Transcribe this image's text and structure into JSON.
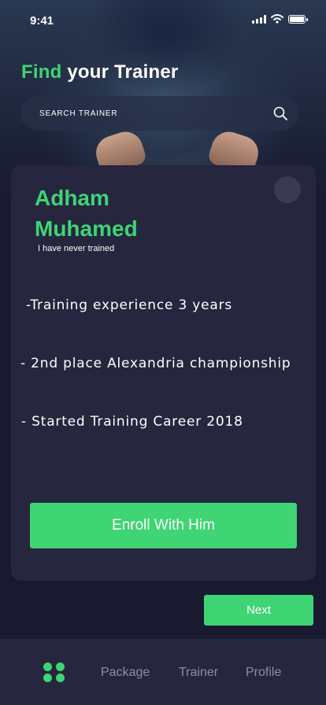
{
  "status_bar": {
    "time": "9:41"
  },
  "header": {
    "title_accent": "Find",
    "title_rest": "your Trainer"
  },
  "search": {
    "placeholder": "SEARCH TRAINER"
  },
  "trainer": {
    "name": "Adham Muhamed",
    "subtitle": "I have never trained",
    "facts": [
      " -Training experience 3 years",
      "- 2nd place Alexandria championship",
      "- Started Training Career 2018"
    ],
    "enroll_label": "Enroll With Him"
  },
  "next_label": "Next",
  "tabs": [
    {
      "label": "Package"
    },
    {
      "label": "Trainer"
    },
    {
      "label": "Profile"
    }
  ],
  "colors": {
    "accent": "#3fd474",
    "background": "#191a2f",
    "card": "#26263f"
  }
}
